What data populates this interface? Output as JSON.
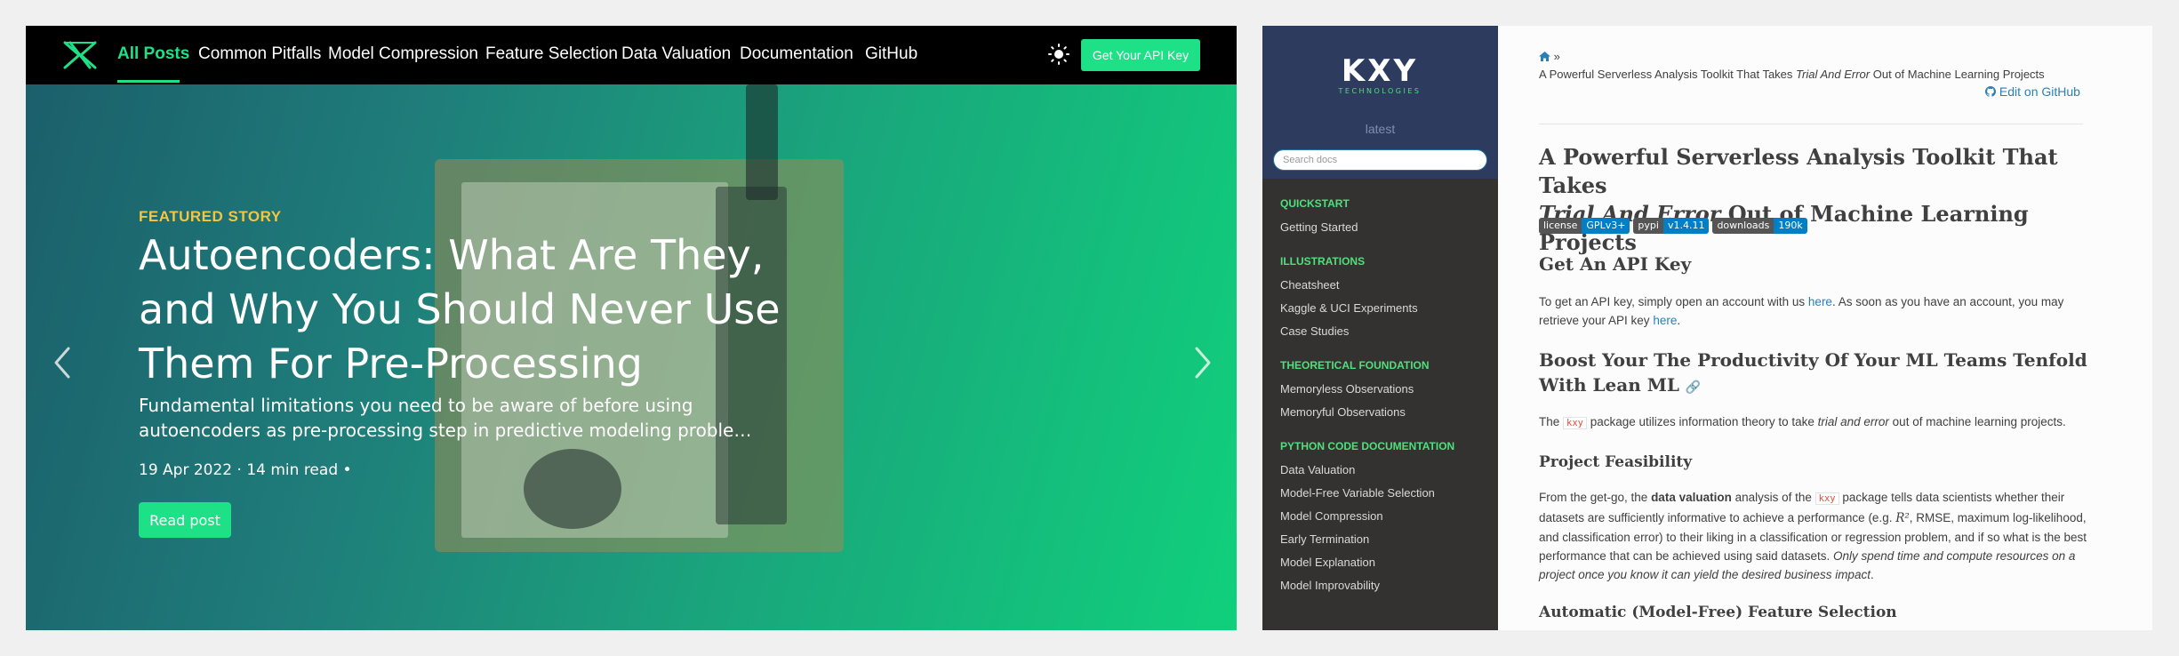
{
  "blog": {
    "nav": {
      "items": [
        "All Posts",
        "Common Pitfalls",
        "Model Compression",
        "Feature Selection",
        "Data Valuation",
        "Documentation",
        "GitHub"
      ],
      "active_index": 0,
      "api_button": "Get Your API Key"
    },
    "hero": {
      "kicker": "FEATURED STORY",
      "title": "Autoencoders: What Are They, and Why You Should Never Use Them For Pre-Processing",
      "subtitle_line1": "Fundamental limitations you need to be aware of before using",
      "subtitle_line2": "autoencoders as pre-processing step in predictive modeling problems on...",
      "meta": "19 Apr 2022 · 14 min read •",
      "read_button": "Read post"
    },
    "colors": {
      "accent": "#1ee087",
      "kicker": "#f4c542"
    },
    "icons": [
      "logo-icon",
      "sun-icon",
      "chevron-left-icon",
      "chevron-right-icon"
    ]
  },
  "docs": {
    "brand_text": "KXY",
    "brand_sub": "TECHNOLOGIES",
    "version": "latest",
    "search_placeholder": "Search docs",
    "sections": [
      {
        "caption": "QUICKSTART",
        "items": [
          "Getting Started"
        ]
      },
      {
        "caption": "ILLUSTRATIONS",
        "items": [
          "Cheatsheet",
          "Kaggle & UCI Experiments",
          "Case Studies"
        ]
      },
      {
        "caption": "THEORETICAL FOUNDATION",
        "items": [
          "Memoryless Observations",
          "Memoryful Observations"
        ]
      },
      {
        "caption": "PYTHON CODE DOCUMENTATION",
        "items": [
          "Data Valuation",
          "Model-Free Variable Selection",
          "Model Compression",
          "Early Termination",
          "Model Explanation",
          "Model Improvability"
        ]
      }
    ],
    "breadcrumb_sep": "»",
    "breadcrumb_title_pre": "A Powerful Serverless Analysis Toolkit That Takes ",
    "breadcrumb_title_em": "Trial And Error",
    "breadcrumb_title_post": " Out of Machine Learning Projects",
    "edit_github": "Edit on GitHub",
    "h1_line1": "A Powerful Serverless Analysis Toolkit That Takes",
    "h1_em": "Trial And Error",
    "h1_post": " Out of Machine Learning Projects",
    "badges": [
      {
        "key": "license",
        "value": "GPLv3+"
      },
      {
        "key": "pypi",
        "value": "v1.4.11"
      },
      {
        "key": "downloads",
        "value": "190k"
      }
    ],
    "h2_api": "Get An API Key",
    "p_api_1": "To get an API key, simply open an account with us ",
    "p_api_link1": "here",
    "p_api_2": ". As soon as you have an account, you may retrieve your API key ",
    "p_api_link2": "here",
    "p_api_3": ".",
    "h2_boost": "Boost Your The Productivity Of Your ML Teams Tenfold With Lean ML",
    "p_boost_1": "The ",
    "code_kxy": "kxy",
    "p_boost_2": " package utilizes information theory to take ",
    "p_boost_em": "trial and error",
    "p_boost_3": " out of machine learning projects.",
    "h3_feas": "Project Feasibility",
    "p_feas_1": "From the get-go, the ",
    "p_feas_strong": "data valuation",
    "p_feas_2": " analysis of the ",
    "p_feas_3": " package tells data scientists whether their datasets are sufficiently informative to achieve a performance (e.g. ",
    "p_feas_math": "R²",
    "p_feas_4": ", RMSE, maximum log-likelihood, and classification error) to their liking in a classification or regression problem, and if so what is the best performance that can be achieved using said datasets. ",
    "p_feas_em": "Only spend time and compute resources on a project once you know it can yield the desired business impact",
    "p_feas_5": ".",
    "h3_auto": "Automatic (Model-Free) Feature Selection",
    "colors": {
      "link": "#2980b9",
      "caption": "#4ee07a",
      "sidebar": "#343131",
      "sidebar_top": "#2d3b5e",
      "badge_key": "#555555",
      "badge_value": "#007ec6"
    },
    "icons": [
      "home-icon",
      "github-icon",
      "link-icon"
    ]
  }
}
